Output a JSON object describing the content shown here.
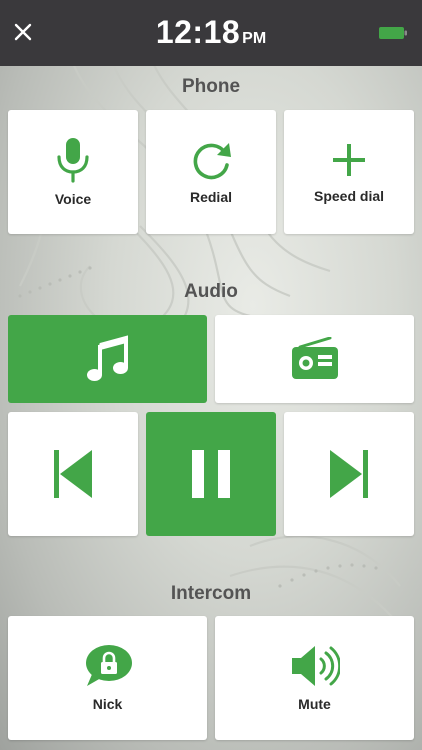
{
  "status_bar": {
    "time": "12:18",
    "ampm": "PM",
    "battery_color": "#43a648"
  },
  "close_icon": "close-icon",
  "accent_color": "#43a648",
  "sections": {
    "phone": {
      "title": "Phone",
      "buttons": [
        {
          "label": "Voice",
          "icon": "microphone-icon"
        },
        {
          "label": "Redial",
          "icon": "redial-icon"
        },
        {
          "label": "Speed dial",
          "icon": "plus-icon"
        }
      ]
    },
    "audio": {
      "title": "Audio",
      "sources": [
        {
          "icon": "music-note-icon",
          "active": true
        },
        {
          "icon": "radio-icon",
          "active": false
        }
      ],
      "controls": [
        {
          "icon": "previous-track-icon",
          "active": false
        },
        {
          "icon": "pause-icon",
          "active": true
        },
        {
          "icon": "next-track-icon",
          "active": false
        }
      ]
    },
    "intercom": {
      "title": "Intercom",
      "buttons": [
        {
          "label": "Nick",
          "icon": "chat-lock-icon"
        },
        {
          "label": "Mute",
          "icon": "speaker-icon"
        }
      ]
    }
  }
}
